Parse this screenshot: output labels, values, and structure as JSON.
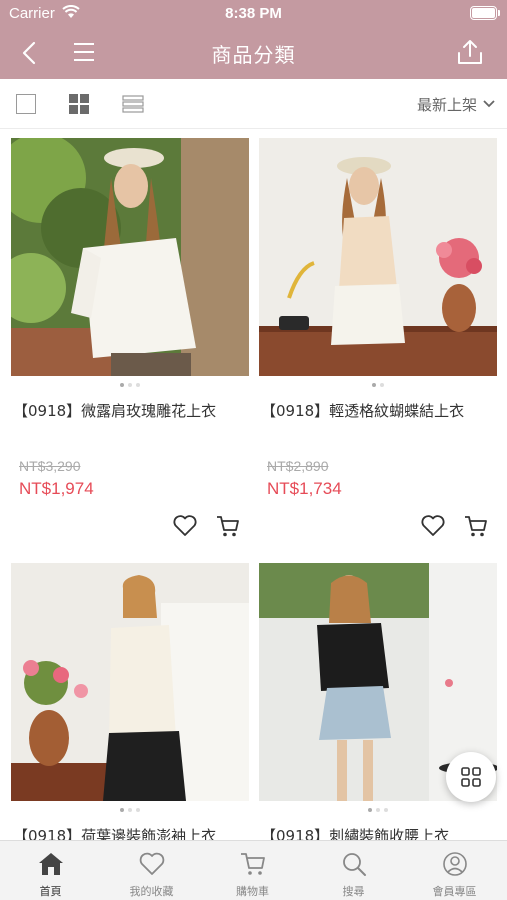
{
  "status": {
    "carrier": "Carrier",
    "time": "8:38 PM"
  },
  "nav": {
    "title": "商品分類"
  },
  "toolbar": {
    "sort_label": "最新上架"
  },
  "products": [
    {
      "name": "【0918】微露肩玫瑰雕花上衣",
      "original_price": "NT$3,290",
      "sale_price": "NT$1,974"
    },
    {
      "name": "【0918】輕透格紋蝴蝶結上衣",
      "original_price": "NT$2,890",
      "sale_price": "NT$1,734"
    },
    {
      "name": "【0918】荷葉邊裝飾澎袖上衣"
    },
    {
      "name": "【0918】刺繡裝飾收腰上衣"
    }
  ],
  "tabs": [
    {
      "label": "首頁",
      "icon": "home-icon"
    },
    {
      "label": "我的收藏",
      "icon": "heart-icon"
    },
    {
      "label": "購物車",
      "icon": "cart-icon"
    },
    {
      "label": "搜尋",
      "icon": "search-icon"
    },
    {
      "label": "會員專區",
      "icon": "user-icon"
    }
  ],
  "colors": {
    "header": "#c49aa1",
    "price": "#e64b57"
  }
}
